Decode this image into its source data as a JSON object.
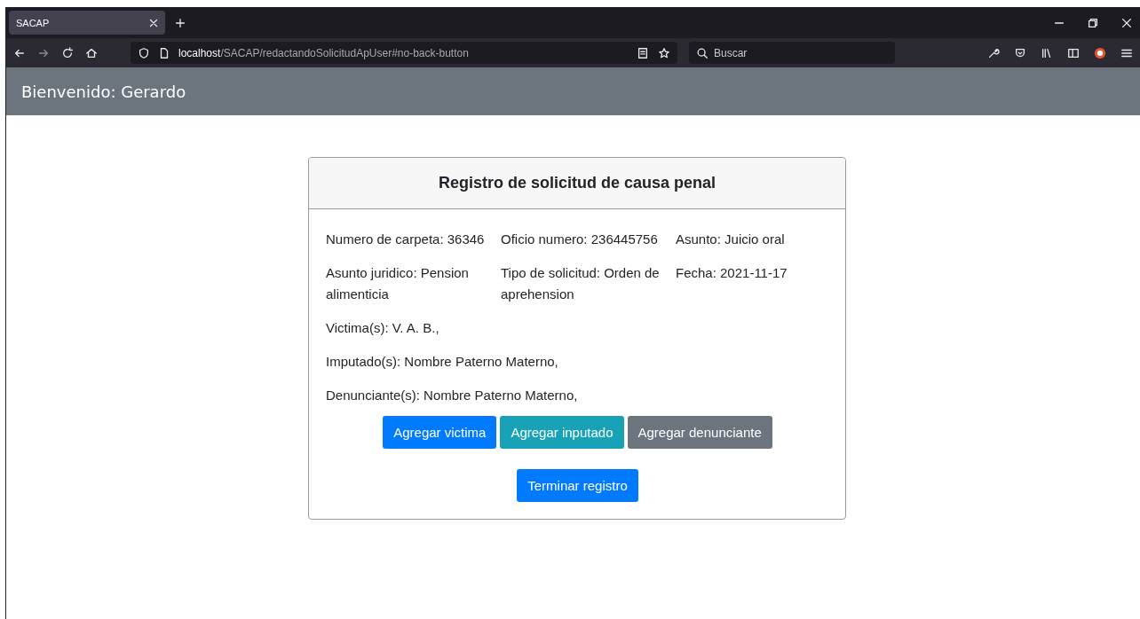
{
  "browser": {
    "tab_title": "SACAP",
    "url_host": "localhost",
    "url_path": "/SACAP/redactandoSolicitudApUser#no-back-button",
    "search": {
      "placeholder": "Buscar"
    }
  },
  "header": {
    "greeting": "Bienvenido: Gerardo"
  },
  "card": {
    "title": "Registro de solicitud de causa penal",
    "fields": [
      {
        "text": "Numero de carpeta: 36346"
      },
      {
        "text": "Oficio numero: 236445756"
      },
      {
        "text": "Asunto: Juicio oral"
      },
      {
        "text": "Asunto juridico: Pension alimenticia"
      },
      {
        "text": "Tipo de solicitud: Orden de aprehension"
      },
      {
        "text": "Fecha: 2021-11-17"
      }
    ],
    "lines": [
      "Victima(s): V. A. B.,",
      "Imputado(s): Nombre Paterno Materno,",
      "Denunciante(s): Nombre Paterno Materno,"
    ],
    "buttons": [
      {
        "label": "Agregar victima",
        "kind": "primary"
      },
      {
        "label": "Agregar inputado",
        "kind": "info"
      },
      {
        "label": "Agregar denunciante",
        "kind": "secondary"
      }
    ],
    "finish_button": {
      "label": "Terminar registro",
      "kind": "primary"
    }
  }
}
